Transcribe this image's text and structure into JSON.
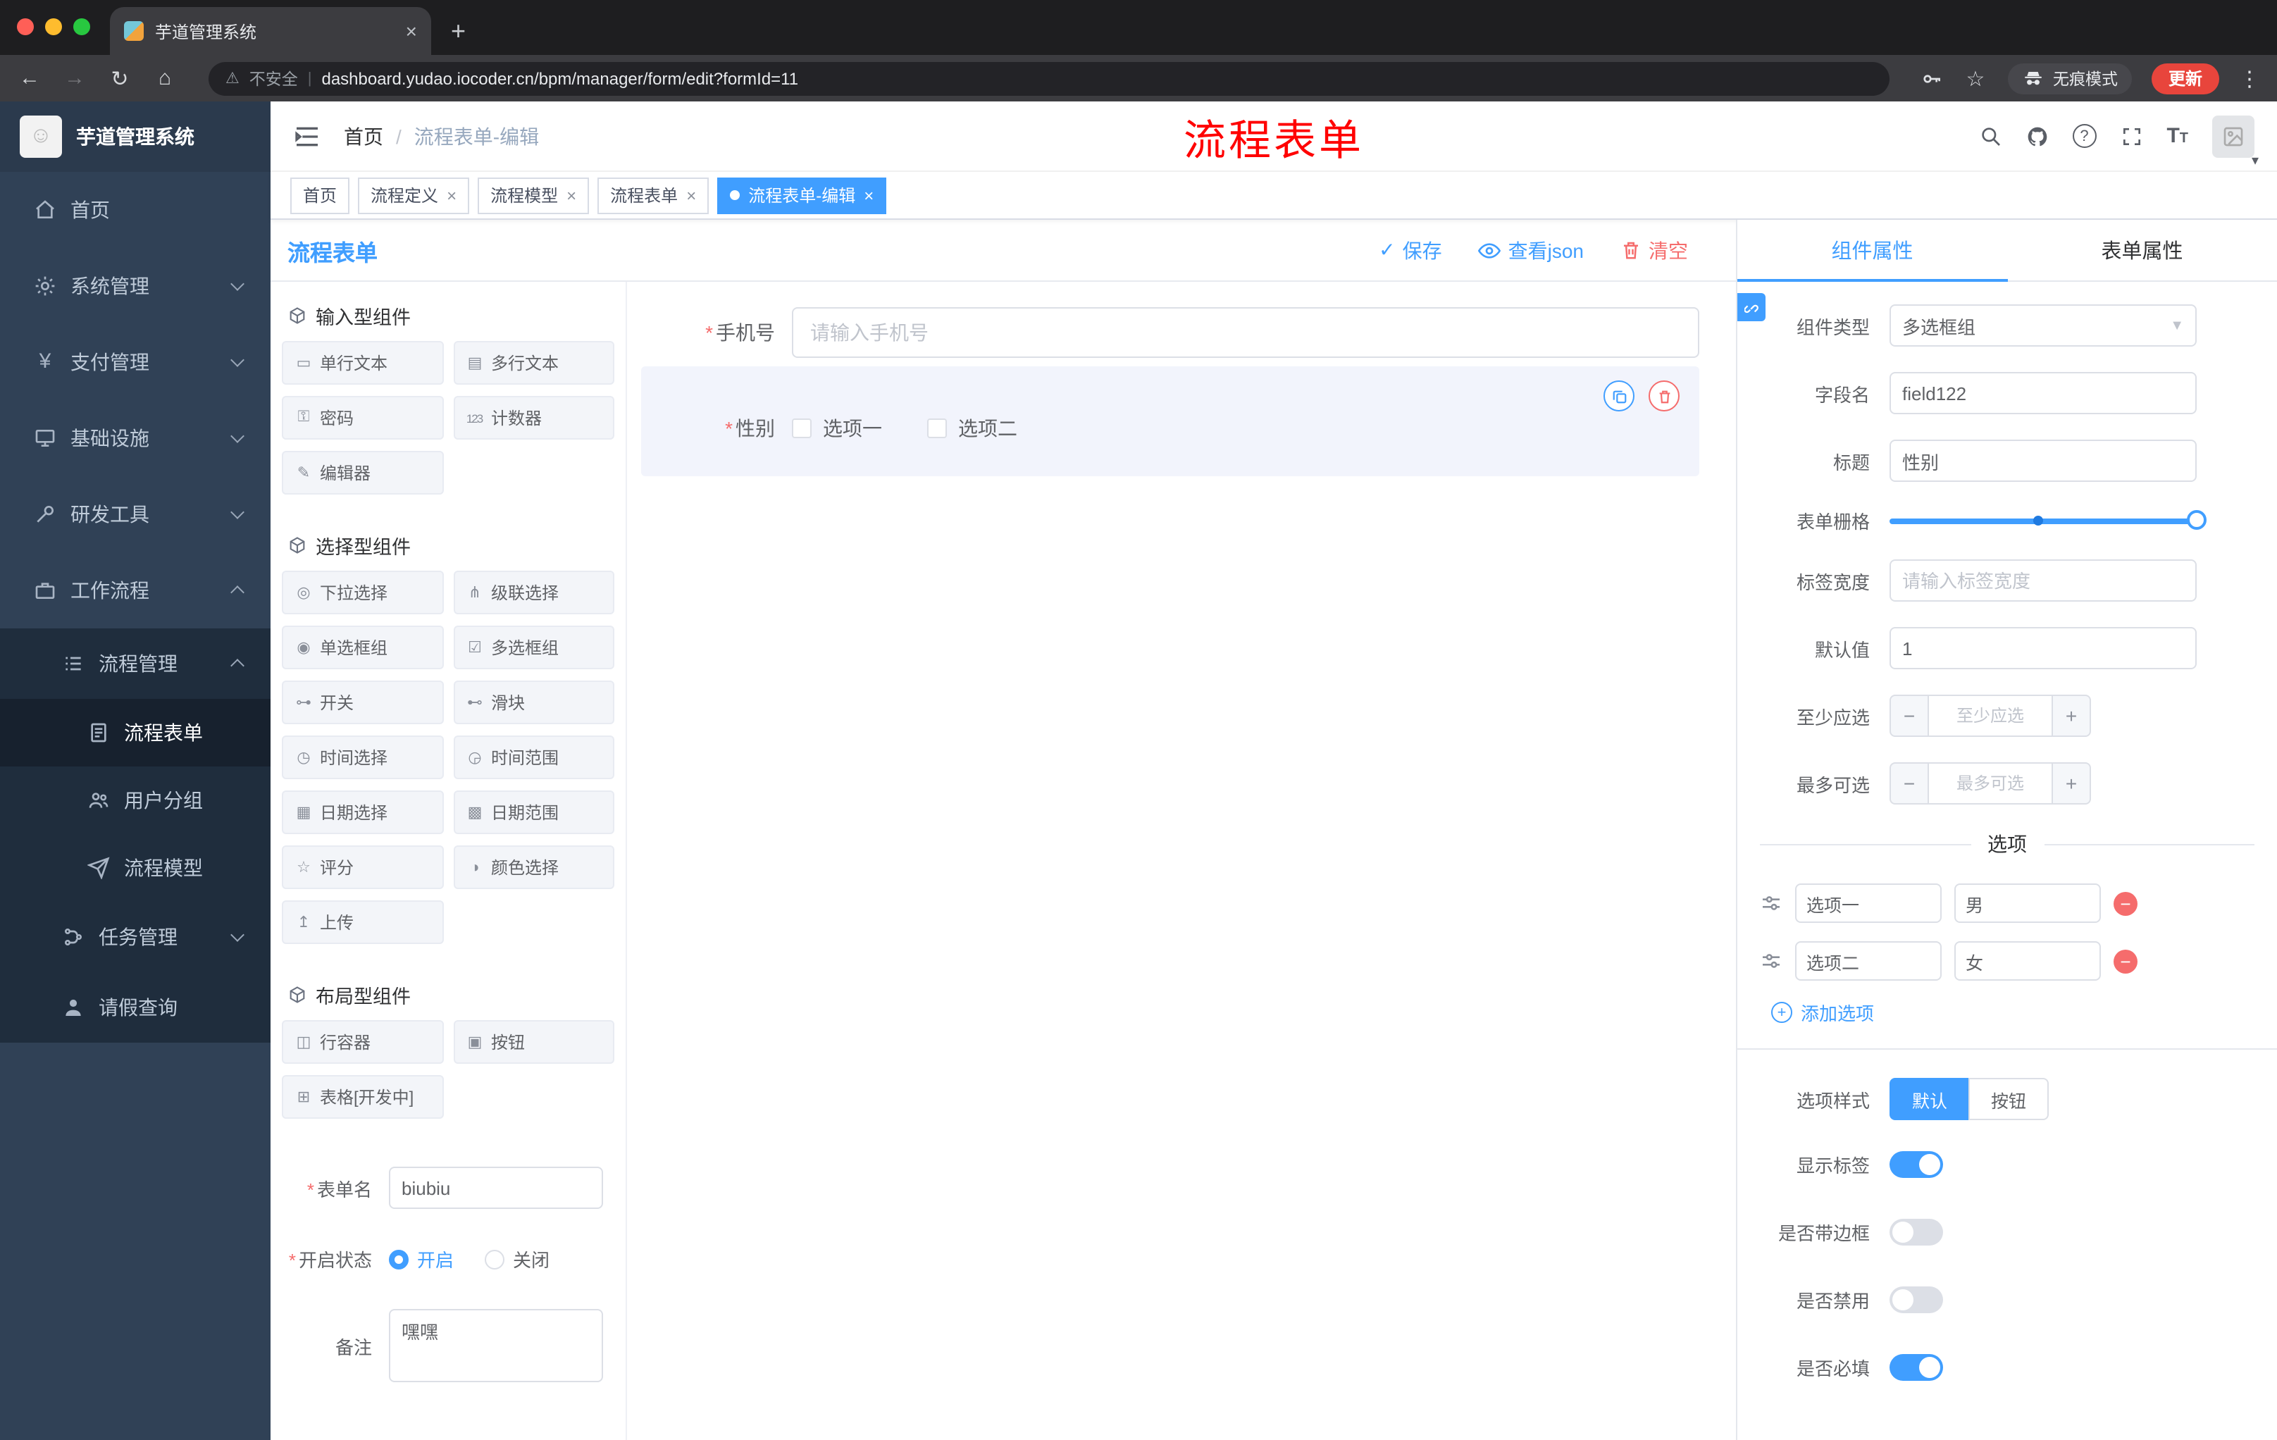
{
  "browser": {
    "tab_title": "芋道管理系统",
    "security_label": "不安全",
    "url": "dashboard.yudao.iocoder.cn/bpm/manager/form/edit?formId=11",
    "incognito_label": "无痕模式",
    "update_label": "更新"
  },
  "sidebar": {
    "logo_title": "芋道管理系统",
    "items": [
      {
        "label": "首页"
      },
      {
        "label": "系统管理"
      },
      {
        "label": "支付管理"
      },
      {
        "label": "基础设施"
      },
      {
        "label": "研发工具"
      },
      {
        "label": "工作流程"
      },
      {
        "label": "流程管理"
      },
      {
        "label": "流程表单"
      },
      {
        "label": "用户分组"
      },
      {
        "label": "流程模型"
      },
      {
        "label": "任务管理"
      },
      {
        "label": "请假查询"
      }
    ]
  },
  "navbar": {
    "breadcrumb_home": "首页",
    "breadcrumb_current": "流程表单-编辑",
    "annotation": "流程表单"
  },
  "page_tabs": [
    {
      "label": "首页"
    },
    {
      "label": "流程定义"
    },
    {
      "label": "流程模型"
    },
    {
      "label": "流程表单"
    },
    {
      "label": "流程表单-编辑"
    }
  ],
  "designer": {
    "title": "流程表单",
    "save": "保存",
    "view_json": "查看json",
    "clear": "清空",
    "sections": {
      "input_title": "输入型组件",
      "select_title": "选择型组件",
      "layout_title": "布局型组件"
    },
    "input_items": [
      {
        "label": "单行文本",
        "icon": "▭"
      },
      {
        "label": "多行文本",
        "icon": "▤"
      },
      {
        "label": "密码",
        "icon": "⚿"
      },
      {
        "label": "计数器",
        "icon": "123"
      },
      {
        "label": "编辑器",
        "icon": "✎"
      }
    ],
    "select_items": [
      {
        "label": "下拉选择",
        "icon": "◎"
      },
      {
        "label": "级联选择",
        "icon": "⋔"
      },
      {
        "label": "单选框组",
        "icon": "◉"
      },
      {
        "label": "多选框组",
        "icon": "☑"
      },
      {
        "label": "开关",
        "icon": "⊶"
      },
      {
        "label": "滑块",
        "icon": "⊷"
      },
      {
        "label": "时间选择",
        "icon": "◷"
      },
      {
        "label": "时间范围",
        "icon": "◶"
      },
      {
        "label": "日期选择",
        "icon": "▦"
      },
      {
        "label": "日期范围",
        "icon": "▩"
      },
      {
        "label": "评分",
        "icon": "☆"
      },
      {
        "label": "颜色选择",
        "icon": "◑"
      },
      {
        "label": "上传",
        "icon": "↥"
      }
    ],
    "layout_items": [
      {
        "label": "行容器",
        "icon": "◫"
      },
      {
        "label": "按钮",
        "icon": "▣"
      },
      {
        "label": "表格[开发中]",
        "icon": "⊞"
      }
    ],
    "meta": {
      "name_label": "表单名",
      "name_value": "biubiu",
      "status_label": "开启状态",
      "status_on": "开启",
      "status_off": "关闭",
      "remark_label": "备注",
      "remark_value": "嘿嘿"
    },
    "canvas": {
      "phone_label": "手机号",
      "phone_placeholder": "请输入手机号",
      "gender_label": "性别",
      "gender_option1": "选项一",
      "gender_option2": "选项二"
    }
  },
  "props": {
    "tab_component": "组件属性",
    "tab_form": "表单属性",
    "type_label": "组件类型",
    "type_value": "多选框组",
    "field_label": "字段名",
    "field_value": "field122",
    "title_label": "标题",
    "title_value": "性别",
    "grid_label": "表单栅格",
    "width_label": "标签宽度",
    "width_placeholder": "请输入标签宽度",
    "default_label": "默认值",
    "default_value": "1",
    "min_label": "至少应选",
    "min_placeholder": "至少应选",
    "max_label": "最多可选",
    "max_placeholder": "最多可选",
    "options_title": "选项",
    "options": [
      {
        "label": "选项一",
        "value": "男"
      },
      {
        "label": "选项二",
        "value": "女"
      }
    ],
    "add_option": "添加选项",
    "style_label": "选项样式",
    "style_default": "默认",
    "style_button": "按钮",
    "switch_show_label": "显示标签",
    "switch_border": "是否带边框",
    "switch_disabled": "是否禁用",
    "switch_required": "是否必填"
  }
}
